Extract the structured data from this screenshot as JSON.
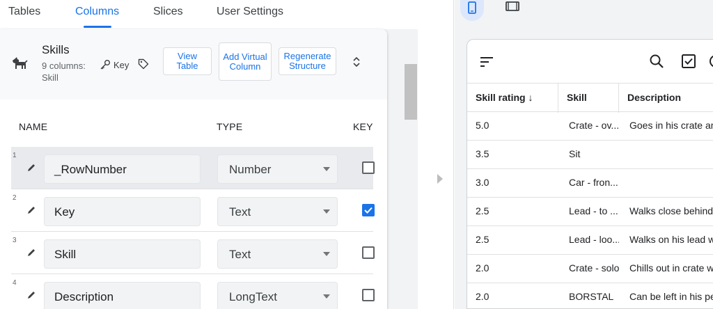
{
  "tabs": [
    {
      "label": "Tables"
    },
    {
      "label": "Columns"
    },
    {
      "label": "Slices"
    },
    {
      "label": "User Settings"
    }
  ],
  "active_tab": "Columns",
  "table": {
    "name": "Skills",
    "column_count": "9 columns:",
    "label_column": "Skill",
    "key_label": "Key",
    "buttons": {
      "view_table": "View Table",
      "add_virtual_column": "Add Virtual Column",
      "regenerate_structure": "Regenerate Structure"
    }
  },
  "columns_header": {
    "name": "NAME",
    "type": "TYPE",
    "key": "KEY?"
  },
  "column_rows": [
    {
      "num": "1",
      "name": "_RowNumber",
      "type": "Number",
      "key": false
    },
    {
      "num": "2",
      "name": "Key",
      "type": "Text",
      "key": true
    },
    {
      "num": "3",
      "name": "Skill",
      "type": "Text",
      "key": false
    },
    {
      "num": "4",
      "name": "Description",
      "type": "LongText",
      "key": false
    }
  ],
  "preview": {
    "headers": {
      "rating": "Skill rating ↓",
      "skill": "Skill",
      "description": "Description"
    },
    "rows": [
      {
        "rating": "5.0",
        "skill": "Crate - ov...",
        "description": "Goes in his crate and"
      },
      {
        "rating": "3.5",
        "skill": "Sit",
        "description": ""
      },
      {
        "rating": "3.0",
        "skill": "Car - fron...",
        "description": ""
      },
      {
        "rating": "2.5",
        "skill": "Lead - to ...",
        "description": "Walks close behind"
      },
      {
        "rating": "2.5",
        "skill": "Lead - loo...",
        "description": "Walks on his lead w"
      },
      {
        "rating": "2.0",
        "skill": "Crate - solo",
        "description": "Chills out in crate w"
      },
      {
        "rating": "2.0",
        "skill": "BORSTAL",
        "description": "Can be left in his pe"
      }
    ]
  },
  "colors": {
    "accent": "#1a73e8",
    "selected_row": "#e8eaed",
    "device_active": "#dde7fb"
  }
}
